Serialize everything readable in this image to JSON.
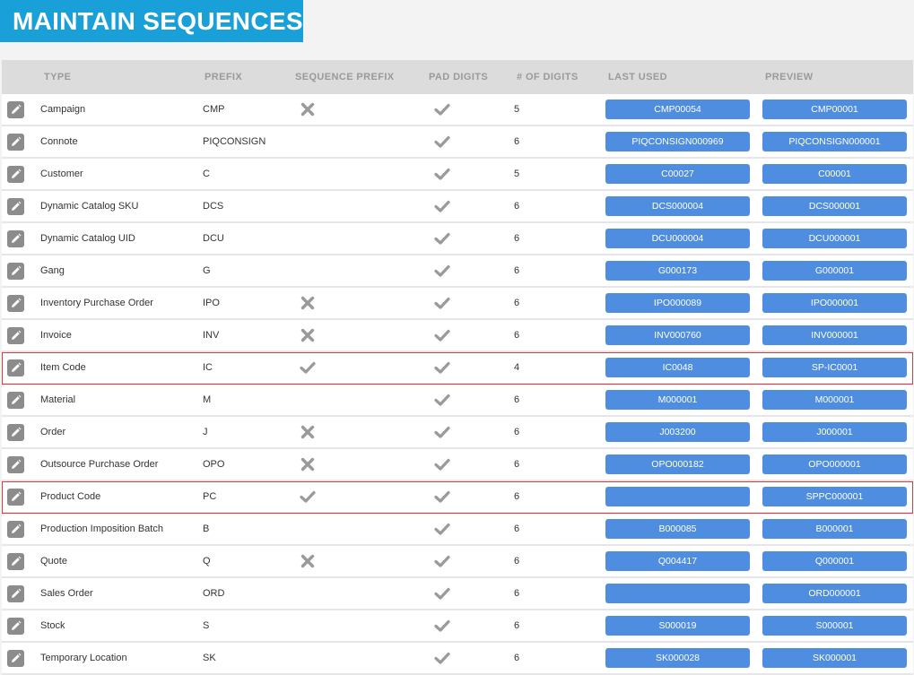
{
  "page_title": "MAINTAIN SEQUENCES",
  "columns": {
    "type": "TYPE",
    "prefix": "PREFIX",
    "sequence_prefix": "SEQUENCE PREFIX",
    "pad_digits": "PAD DIGITS",
    "num_digits": "# OF DIGITS",
    "last_used": "LAST USED",
    "preview": "PREVIEW"
  },
  "colors": {
    "title_bg": "#1aa0d8",
    "pill_bg": "#4f8de0",
    "highlight_border": "#e03a3a"
  },
  "rows": [
    {
      "type": "Campaign",
      "prefix": "CMP",
      "sequence_prefix": "cross",
      "pad_digits": "check",
      "num_digits": "5",
      "last_used": "CMP00054",
      "preview": "CMP00001",
      "highlighted": false
    },
    {
      "type": "Connote",
      "prefix": "PIQCONSIGN",
      "sequence_prefix": "none",
      "pad_digits": "check",
      "num_digits": "6",
      "last_used": "PIQCONSIGN000969",
      "preview": "PIQCONSIGN000001",
      "highlighted": false
    },
    {
      "type": "Customer",
      "prefix": "C",
      "sequence_prefix": "none",
      "pad_digits": "check",
      "num_digits": "5",
      "last_used": "C00027",
      "preview": "C00001",
      "highlighted": false
    },
    {
      "type": "Dynamic Catalog SKU",
      "prefix": "DCS",
      "sequence_prefix": "none",
      "pad_digits": "check",
      "num_digits": "6",
      "last_used": "DCS000004",
      "preview": "DCS000001",
      "highlighted": false
    },
    {
      "type": "Dynamic Catalog UID",
      "prefix": "DCU",
      "sequence_prefix": "none",
      "pad_digits": "check",
      "num_digits": "6",
      "last_used": "DCU000004",
      "preview": "DCU000001",
      "highlighted": false
    },
    {
      "type": "Gang",
      "prefix": "G",
      "sequence_prefix": "none",
      "pad_digits": "check",
      "num_digits": "6",
      "last_used": "G000173",
      "preview": "G000001",
      "highlighted": false
    },
    {
      "type": "Inventory Purchase Order",
      "prefix": "IPO",
      "sequence_prefix": "cross",
      "pad_digits": "check",
      "num_digits": "6",
      "last_used": "IPO000089",
      "preview": "IPO000001",
      "highlighted": false
    },
    {
      "type": "Invoice",
      "prefix": "INV",
      "sequence_prefix": "cross",
      "pad_digits": "check",
      "num_digits": "6",
      "last_used": "INV000760",
      "preview": "INV000001",
      "highlighted": false
    },
    {
      "type": "Item Code",
      "prefix": "IC",
      "sequence_prefix": "check",
      "pad_digits": "check",
      "num_digits": "4",
      "last_used": "IC0048",
      "preview": "SP-IC0001",
      "highlighted": true
    },
    {
      "type": "Material",
      "prefix": "M",
      "sequence_prefix": "none",
      "pad_digits": "check",
      "num_digits": "6",
      "last_used": "M000001",
      "preview": "M000001",
      "highlighted": false
    },
    {
      "type": "Order",
      "prefix": "J",
      "sequence_prefix": "cross",
      "pad_digits": "check",
      "num_digits": "6",
      "last_used": "J003200",
      "preview": "J000001",
      "highlighted": false
    },
    {
      "type": "Outsource Purchase Order",
      "prefix": "OPO",
      "sequence_prefix": "cross",
      "pad_digits": "check",
      "num_digits": "6",
      "last_used": "OPO000182",
      "preview": "OPO000001",
      "highlighted": false
    },
    {
      "type": "Product Code",
      "prefix": "PC",
      "sequence_prefix": "check",
      "pad_digits": "check",
      "num_digits": "6",
      "last_used": "",
      "preview": "SPPC000001",
      "highlighted": true
    },
    {
      "type": "Production Imposition Batch",
      "prefix": "B",
      "sequence_prefix": "none",
      "pad_digits": "check",
      "num_digits": "6",
      "last_used": "B000085",
      "preview": "B000001",
      "highlighted": false
    },
    {
      "type": "Quote",
      "prefix": "Q",
      "sequence_prefix": "cross",
      "pad_digits": "check",
      "num_digits": "6",
      "last_used": "Q004417",
      "preview": "Q000001",
      "highlighted": false
    },
    {
      "type": "Sales Order",
      "prefix": "ORD",
      "sequence_prefix": "none",
      "pad_digits": "check",
      "num_digits": "6",
      "last_used": "",
      "preview": "ORD000001",
      "highlighted": false
    },
    {
      "type": "Stock",
      "prefix": "S",
      "sequence_prefix": "none",
      "pad_digits": "check",
      "num_digits": "6",
      "last_used": "S000019",
      "preview": "S000001",
      "highlighted": false
    },
    {
      "type": "Temporary Location",
      "prefix": "SK",
      "sequence_prefix": "none",
      "pad_digits": "check",
      "num_digits": "6",
      "last_used": "SK000028",
      "preview": "SK000001",
      "highlighted": false
    }
  ]
}
